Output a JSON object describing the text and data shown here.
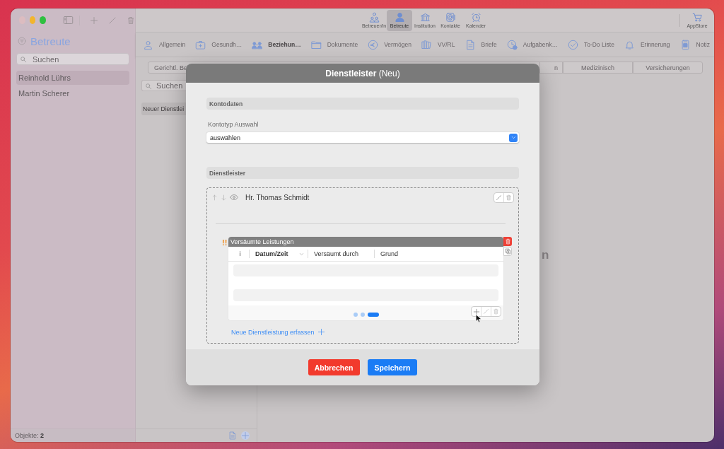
{
  "window": {
    "sidebar": {
      "title": "Betreute",
      "search": {
        "placeholder": "Suchen"
      },
      "items": [
        {
          "label": "Reinhold Lührs",
          "selected": true
        },
        {
          "label": "Martin Scherer",
          "selected": false
        }
      ],
      "status": "Objekte: **2**"
    },
    "toolbar": {
      "items": [
        {
          "label": "Betreuer/in",
          "selected": false
        },
        {
          "label": "Betreute",
          "selected": true
        },
        {
          "label": "Institution",
          "selected": false
        },
        {
          "label": "Kontakte",
          "selected": false
        },
        {
          "label": "Kalender",
          "selected": false
        }
      ],
      "store": {
        "label": "AppStore"
      }
    },
    "categories": [
      {
        "label": "Allgemein",
        "selected": false
      },
      {
        "label": "Gesundh…",
        "selected": false
      },
      {
        "label": "Beziehun…",
        "selected": true
      },
      {
        "label": "Dokumente",
        "selected": false
      },
      {
        "label": "Vermögen",
        "selected": false
      },
      {
        "label": "VV/RL",
        "selected": false
      },
      {
        "label": "Briefe",
        "selected": false
      },
      {
        "label": "Aufgabenk…",
        "selected": false
      },
      {
        "label": "To-Do Liste",
        "selected": false
      },
      {
        "label": "Erinnerung",
        "selected": false
      },
      {
        "label": "Notiz",
        "selected": false
      }
    ],
    "segments": [
      {
        "label": "Gerichtl. Be"
      },
      {
        "label": "n"
      },
      {
        "label": "Medizinisch"
      },
      {
        "label": "Versicherungen"
      }
    ],
    "list": {
      "search": {
        "placeholder": "Suchen"
      },
      "items": [
        {
          "label": "Neuer Dienstlei",
          "selected": true
        }
      ]
    },
    "empty_state": "n"
  },
  "dialog": {
    "title": "**Dienstleister** (Neu)",
    "account": {
      "heading": "Kontodaten",
      "field_label": "Kontotyp Auswahl",
      "select": {
        "value": "auswählen"
      }
    },
    "providers": {
      "heading": "Dienstleister",
      "entries": [
        {
          "name": "Hr. Thomas Schmidt",
          "table": {
            "flag": "!!",
            "title": "Versäumte Leistungen",
            "columns": [
              {
                "label": "i",
                "sorted": false
              },
              {
                "label": "Datum/Zeit",
                "sorted": true
              },
              {
                "label": "Versäumt durch",
                "sorted": false
              },
              {
                "label": "Grund",
                "sorted": false
              }
            ],
            "rows": [
              {
                "kind": "placeholder"
              },
              {
                "kind": "placeholder"
              }
            ],
            "pages": [
              {
                "selected": false
              },
              {
                "selected": false
              },
              {
                "selected": true
              }
            ]
          }
        }
      ],
      "add_link": "Neue Dienstleistung erfassen"
    },
    "buttons": [
      {
        "label": "Abbrechen",
        "kind": "cancel"
      },
      {
        "label": "Speichern",
        "kind": "primary"
      }
    ]
  }
}
